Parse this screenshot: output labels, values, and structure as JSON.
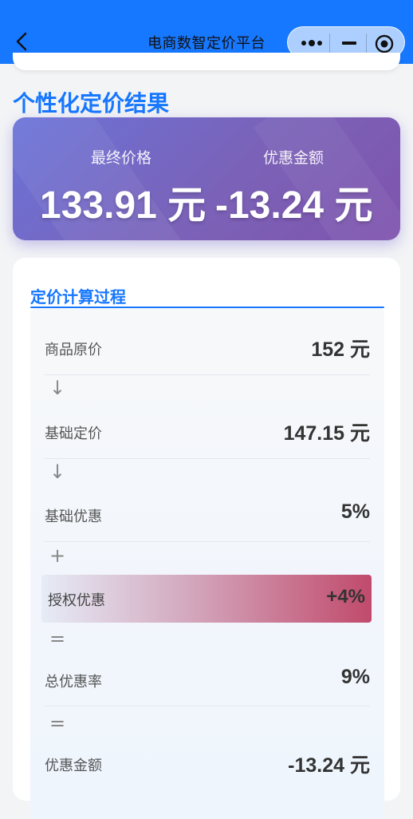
{
  "navbar": {
    "title": "电商数智定价平台",
    "color": "#1677ff"
  },
  "capsule": {
    "more_icon": "more-dots-icon",
    "minimize_icon": "minimize-icon",
    "close_icon": "target-close-icon"
  },
  "section_title": "个性化定价结果",
  "result": {
    "final_price_label": "最终价格",
    "final_price_value": "133.91 元",
    "discount_label": "优惠金额",
    "discount_value": "-13.24 元"
  },
  "process": {
    "title": "定价计算过程",
    "rows": [
      {
        "label": "商品原价",
        "value": "152 元"
      },
      {
        "label": "基础定价",
        "value": "147.15 元"
      },
      {
        "label": "基础优惠",
        "value": "5%"
      },
      {
        "label": "授权优惠",
        "value": "+4%"
      },
      {
        "label": "总优惠率",
        "value": "9%"
      },
      {
        "label": "优惠金额",
        "value": "-13.24 元"
      }
    ],
    "operators": [
      "↓",
      "↓",
      "+",
      "=",
      "="
    ]
  }
}
